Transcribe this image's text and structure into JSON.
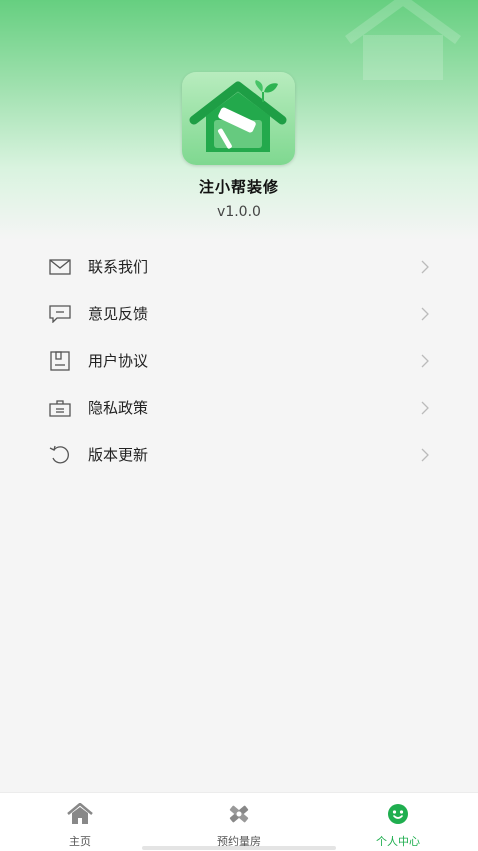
{
  "app": {
    "name": "注小帮装修",
    "version": "v1.0.0"
  },
  "menu": {
    "items": [
      {
        "label": "联系我们",
        "icon": "mail-icon"
      },
      {
        "label": "意见反馈",
        "icon": "message-icon"
      },
      {
        "label": "用户协议",
        "icon": "document-icon"
      },
      {
        "label": "隐私政策",
        "icon": "briefcase-icon"
      },
      {
        "label": "版本更新",
        "icon": "refresh-icon"
      }
    ]
  },
  "tabbar": {
    "tabs": [
      {
        "label": "主页",
        "icon": "home-icon",
        "active": false
      },
      {
        "label": "预约量房",
        "icon": "tools-icon",
        "active": false
      },
      {
        "label": "个人中心",
        "icon": "smiley-icon",
        "active": true
      }
    ]
  },
  "colors": {
    "accent": "#1fae4f",
    "header_green": "#66cf80"
  }
}
